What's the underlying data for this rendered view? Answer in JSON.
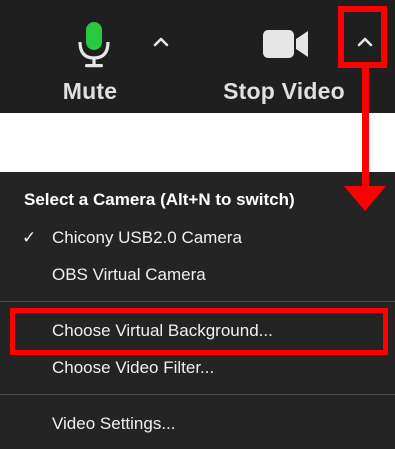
{
  "toolbar": {
    "mute_label": "Mute",
    "stop_video_label": "Stop Video",
    "mic_icon": "microphone-icon",
    "camera_icon": "video-camera-icon",
    "caret_icon": "chevron-up-icon",
    "mic_accent": "#27c93f",
    "background": "#1f1f1f"
  },
  "annotation": {
    "color": "#ff0000"
  },
  "menu": {
    "header": "Select a Camera (Alt+N to switch)",
    "items": [
      {
        "label": "Chicony USB2.0 Camera",
        "checked": true,
        "check_glyph": "✓"
      },
      {
        "label": "OBS Virtual Camera",
        "checked": false
      },
      {
        "label": "Choose Virtual Background...",
        "checked": false
      },
      {
        "label": "Choose Video Filter...",
        "checked": false
      },
      {
        "label": "Video Settings...",
        "checked": false
      }
    ],
    "background": "#242424"
  }
}
